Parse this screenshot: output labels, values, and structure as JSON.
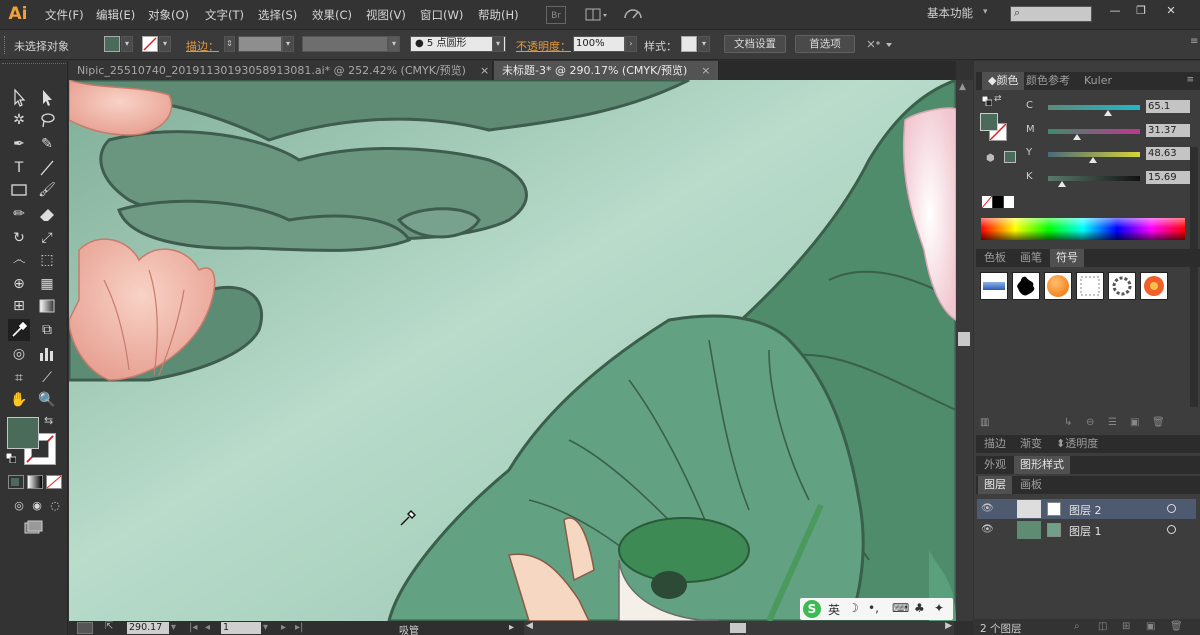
{
  "app": {
    "logo": "Ai"
  },
  "menu": [
    "文件(F)",
    "编辑(E)",
    "对象(O)",
    "文字(T)",
    "选择(S)",
    "效果(C)",
    "视图(V)",
    "窗口(W)",
    "帮助(H)"
  ],
  "menubar": {
    "br_icon": "Br",
    "workspace": "基本功能",
    "window_buttons": [
      "—",
      "❐",
      "✕"
    ]
  },
  "control_bar": {
    "selection_status": "未选择对象",
    "stroke_label": "描边：",
    "brush": "5 点圆形",
    "opacity_label": "不透明度：",
    "opacity_value": "100%",
    "style_label": "样式：",
    "doc_setup_button": "文档设置",
    "preferences_button": "首选项",
    "colors": {
      "fill": "#4b6b5a",
      "label_accent": "#e39a3d"
    }
  },
  "document_tabs": [
    {
      "label": "Nipic_25510740_20191130193058913081.ai* @ 252.42% (CMYK/预览)",
      "active": false,
      "close": "×"
    },
    {
      "label": "未标题-3* @ 290.17% (CMYK/预览)",
      "active": true,
      "close": "×"
    }
  ],
  "status_bar": {
    "zoom": "290.17",
    "artboard": "1",
    "tool_name": "吸管"
  },
  "color_panel": {
    "tabs": [
      "颜色",
      "颜色参考",
      "Kuler"
    ],
    "channels": [
      {
        "label": "C",
        "value": "65.1",
        "level": 0.651,
        "track": "#1eb8c9"
      },
      {
        "label": "M",
        "value": "31.37",
        "level": 0.3137,
        "track": "#c0358f"
      },
      {
        "label": "Y",
        "value": "48.63",
        "level": 0.4863,
        "track": "#d8d43a"
      },
      {
        "label": "K",
        "value": "15.69",
        "level": 0.1569,
        "track": "#111111"
      }
    ]
  },
  "symbols_panel": {
    "tabs": [
      "色板",
      "画笔",
      "符号"
    ],
    "items": [
      "blue-bar-symbol",
      "ink-splat-symbol",
      "orange-ball-symbol",
      "frame-symbol",
      "ring-symbol",
      "flower-symbol"
    ]
  },
  "appearance_tabs": {
    "tabs": [
      "描边",
      "渐变",
      "透明度"
    ]
  },
  "graphic_styles_tabs": {
    "tabs": [
      "外观",
      "图形样式"
    ]
  },
  "layers_panel": {
    "tabs": [
      "图层",
      "画板"
    ],
    "layers": [
      {
        "name": "图层 2",
        "selected": true
      },
      {
        "name": "图层 1",
        "selected": false
      }
    ],
    "footer": "2 个图层"
  },
  "ime": {
    "logo": "S",
    "lang": "英",
    "moon": "☽",
    "punct": "•,",
    "keyboard": "⌨",
    "skin": "♣",
    "tools": "✦"
  }
}
